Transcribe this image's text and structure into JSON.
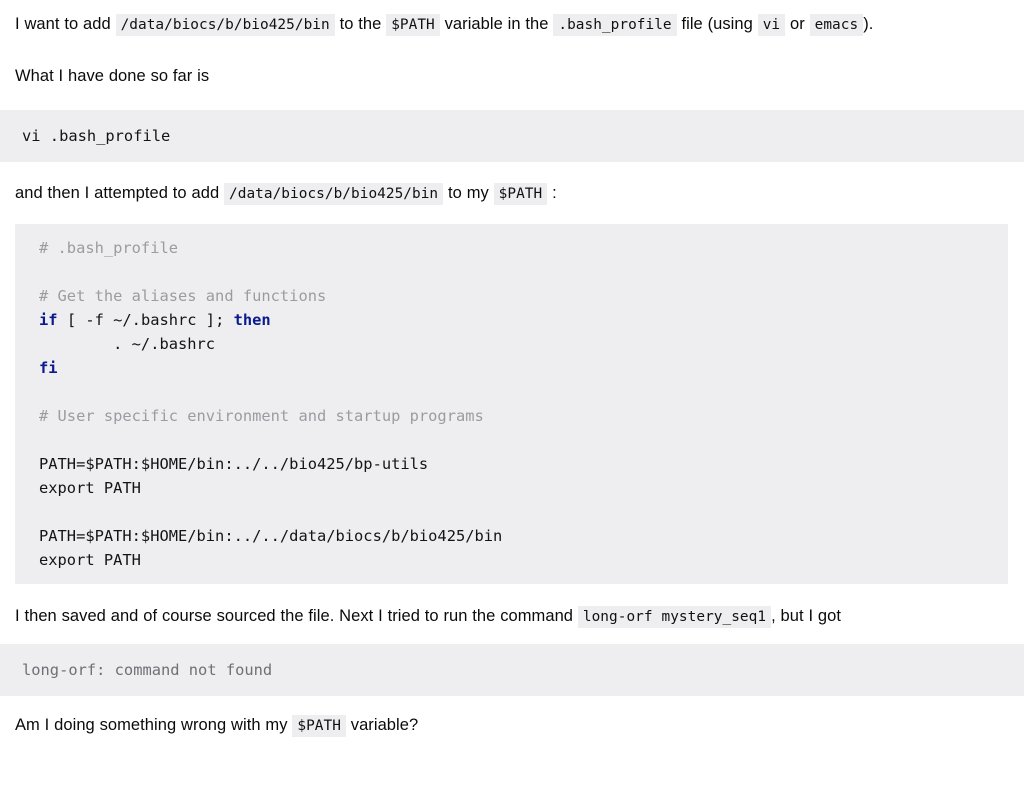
{
  "document": {
    "type": "forum-question-post",
    "paragraphs": {
      "p1": {
        "seg1": "I want to add",
        "code1": "/data/biocs/b/bio425/bin",
        "seg2": "to the",
        "code2": "$PATH",
        "seg3": "variable in the",
        "code3": ".bash_profile",
        "seg4": "file (using",
        "code4": "vi",
        "seg5": "or",
        "code5": "emacs",
        "seg6": ")."
      },
      "p2": {
        "text": "What I have done so far is"
      },
      "p3": {
        "seg1": "and then I attempted to add",
        "code1": "/data/biocs/b/bio425/bin",
        "seg2": "to my",
        "code2": "$PATH",
        "seg3": ":"
      },
      "p4": {
        "seg1": "I then saved and of course sourced the file. Next I tried to run the command",
        "code1": "long-orf mystery_seq1",
        "seg2": ", but I got"
      },
      "p5": {
        "seg1": "Am I doing something wrong with my",
        "code1": "$PATH",
        "seg2": "variable?"
      }
    },
    "code_blocks": {
      "block1": {
        "lines": [
          {
            "text": "vi .bash_profile",
            "token": "plain"
          }
        ]
      },
      "block2": {
        "lines": [
          {
            "text": "# .bash_profile",
            "token": "comment"
          },
          {
            "text": "",
            "token": "plain"
          },
          {
            "text": "# Get the aliases and functions",
            "token": "comment"
          },
          {
            "text": "if",
            "token": "keyword",
            "rest": " [ -f ~/.bashrc ]; ",
            "rest2": "then",
            "token2": "keyword"
          },
          {
            "text": "        . ~/.bashrc",
            "token": "plain"
          },
          {
            "text": "fi",
            "token": "keyword"
          },
          {
            "text": "",
            "token": "plain"
          },
          {
            "text": "# User specific environment and startup programs",
            "token": "comment"
          },
          {
            "text": "",
            "token": "plain"
          },
          {
            "text": "PATH=$PATH:$HOME/bin:../../bio425/bp-utils",
            "token": "plain"
          },
          {
            "text": "export PATH",
            "token": "plain"
          },
          {
            "text": "",
            "token": "plain"
          },
          {
            "text": "PATH=$PATH:$HOME/bin:../../data/biocs/b/bio425/bin",
            "token": "plain"
          },
          {
            "text": "export PATH",
            "token": "plain"
          }
        ],
        "line_if_kw": "if",
        "line_if_mid": " [ -f ~/.bashrc ]; ",
        "line_then_kw": "then",
        "line_bashrc": "        . ~/.bashrc",
        "line_fi": "fi",
        "comment_profile": "# .bash_profile",
        "comment_aliases": "# Get the aliases and functions",
        "comment_user": "# User specific environment and startup programs",
        "path_line_1": "PATH=$PATH:$HOME/bin:../../bio425/bp-utils",
        "export_line_1": "export PATH",
        "path_line_2": "PATH=$PATH:$HOME/bin:../../data/biocs/b/bio425/bin",
        "export_line_2": "export PATH"
      },
      "block3": {
        "lines": [
          {
            "text": "long-orf: command not found",
            "token": "muted"
          }
        ],
        "text": "long-orf: command not found"
      }
    },
    "colors": {
      "page_background": "#ffffff",
      "code_background": "#eeeef0",
      "inline_code_background": "#eeeef0",
      "body_text": "#0b0b0b",
      "comment": "#9b9ba2",
      "keyword": "#0b1a8c",
      "muted_code_text": "#6f6f76"
    }
  }
}
